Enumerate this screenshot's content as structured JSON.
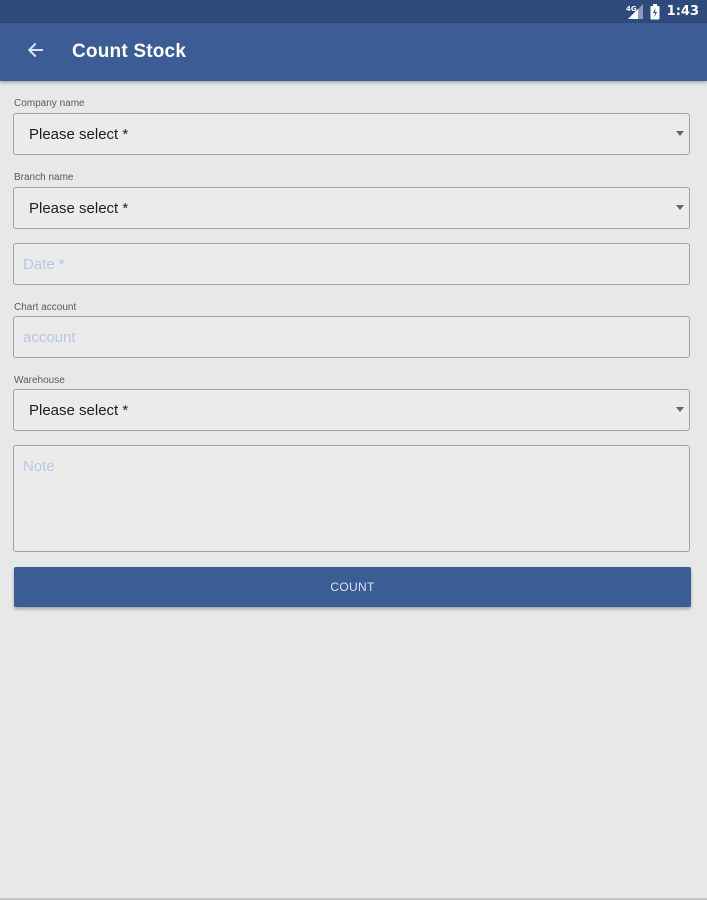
{
  "status_bar": {
    "time": "1:43",
    "icons": [
      "signal-icon",
      "battery-icon"
    ]
  },
  "app_bar": {
    "title": "Count Stock",
    "back_icon": "arrow-back-icon",
    "background": "#3b5c94"
  },
  "form": {
    "company": {
      "label": "Company name",
      "value": "Please select *"
    },
    "branch": {
      "label": "Branch name",
      "value": "Please select *"
    },
    "date": {
      "placeholder": "Date *"
    },
    "chart_account": {
      "label": "Chart account",
      "placeholder": "account"
    },
    "warehouse": {
      "label": "Warehouse",
      "value": "Please select *"
    },
    "note": {
      "placeholder": "Note"
    },
    "count_button": "COUNT"
  },
  "colors": {
    "primary": "#3b5c94",
    "status_bar": "#2f4a7c",
    "background": "#e8e8e8",
    "placeholder": "#b7c6e4"
  }
}
